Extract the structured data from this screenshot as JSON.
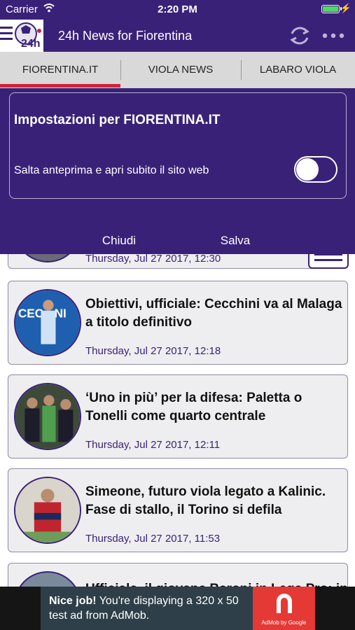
{
  "status_bar": {
    "carrier": "Carrier",
    "time": "2:20 PM"
  },
  "header": {
    "title": "24h News for Fiorentina",
    "logo_text": "24h"
  },
  "tabs": [
    {
      "label": "FIORENTINA.IT",
      "selected": true
    },
    {
      "label": "VIOLA NEWS",
      "selected": false
    },
    {
      "label": "LABARO VIOLA",
      "selected": false
    }
  ],
  "settings": {
    "title": "Impostazioni per FIORENTINA.IT",
    "toggle_label": "Salta anteprima e apri subito il sito web",
    "toggle_on": false,
    "close_label": "Chiudi",
    "save_label": "Salva"
  },
  "news": {
    "partial_top_date": "Thursday, Jul 27 2017, 12:30",
    "items": [
      {
        "headline": "Obiettivi, ufficiale: Cecchini va al Malaga a titolo definitivo",
        "date": "Thursday, Jul 27 2017, 12:18"
      },
      {
        "headline": "‘Uno in più’ per la difesa: Paletta o Tonelli come quarto centrale",
        "date": "Thursday, Jul 27 2017, 12:11"
      },
      {
        "headline": "Simeone, futuro viola legato a Kalinic. Fase di stallo, il Torino si defila",
        "date": "Thursday, Jul 27 2017, 11:53"
      }
    ],
    "partial_bottom_headline": "Ufficiale, il giovane Baroni in Lega Pro: in"
  },
  "ad": {
    "bold": "Nice job!",
    "text": " You're displaying a 320 x 50 test ad from AdMob.",
    "logo_caption": "AdMob by Google"
  },
  "colors": {
    "brand": "#3a2178",
    "accent": "#d0243a",
    "ad_red": "#e53935"
  }
}
